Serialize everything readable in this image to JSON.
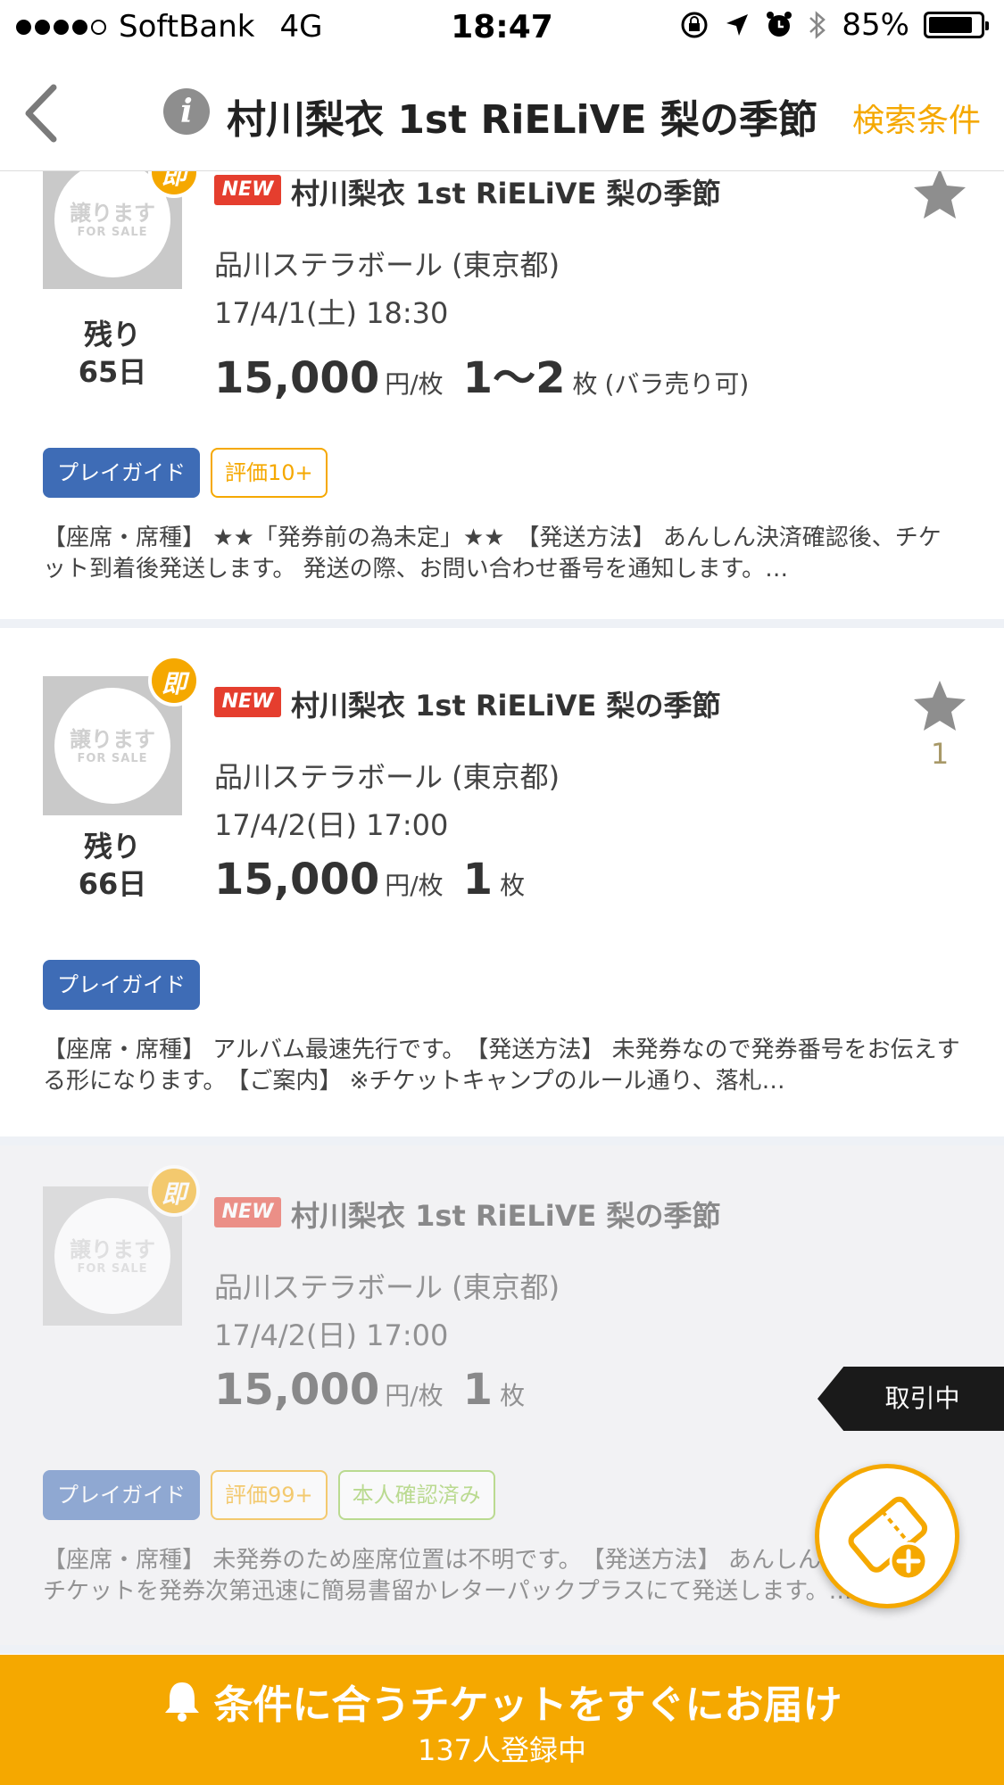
{
  "status_bar": {
    "carrier": "SoftBank",
    "network": "4G",
    "time": "18:47",
    "battery": "85%",
    "battery_level": 0.85
  },
  "nav": {
    "title": "村川梨衣 1st RiELiVE 梨の季節",
    "search_conditions": "検索条件"
  },
  "listings": [
    {
      "thumb_text": "譲ります",
      "thumb_sub": "FOR SALE",
      "instant_label": "即",
      "remaining_label": "残り",
      "remaining_days": "65日",
      "new_label": "NEW",
      "title": "村川梨衣 1st RiELiVE 梨の季節",
      "venue": "品川ステラボール (東京都)",
      "datetime": "17/4/1(土) 18:30",
      "price": "15,000",
      "price_unit": "円/枚",
      "quantity": "1〜2",
      "quantity_unit": "枚",
      "quantity_note": "(バラ売り可)",
      "favorite_count": "",
      "tags": [
        "プレイガイド",
        "評価10+"
      ],
      "description": "【座席・席種】 ★★「発券前の為未定」★★　【発送方法】 あんしん決済確認後、チケット到着後発送します。 発送の際、お問い合わせ番号を通知します。…"
    },
    {
      "thumb_text": "譲ります",
      "thumb_sub": "FOR SALE",
      "instant_label": "即",
      "remaining_label": "残り",
      "remaining_days": "66日",
      "new_label": "NEW",
      "title": "村川梨衣 1st RiELiVE 梨の季節",
      "venue": "品川ステラボール (東京都)",
      "datetime": "17/4/2(日) 17:00",
      "price": "15,000",
      "price_unit": "円/枚",
      "quantity": "1",
      "quantity_unit": "枚",
      "quantity_note": "",
      "favorite_count": "1",
      "tags": [
        "プレイガイド"
      ],
      "description": "【座席・席種】 アルバム最速先行です。　【発送方法】 未発券なので発券番号をお伝えする形になります。　【ご案内】 ※チケットキャンプのルール通り、落札…"
    },
    {
      "thumb_text": "譲ります",
      "thumb_sub": "FOR SALE",
      "instant_label": "即",
      "new_label": "NEW",
      "title": "村川梨衣 1st RiELiVE 梨の季節",
      "venue": "品川ステラボール (東京都)",
      "datetime": "17/4/2(日) 17:00",
      "price": "15,000",
      "price_unit": "円/枚",
      "quantity": "1",
      "quantity_unit": "枚",
      "quantity_note": "",
      "status": "取引中",
      "tags": [
        "プレイガイド",
        "評価99+",
        "本人確認済み"
      ],
      "description": "【座席・席種】 未発券のため座席位置は不明です。　【発送方法】 あんしん決済確認後、チケットを発券次第迅速に簡易書留かレターパックプラスにて発送します。…"
    }
  ],
  "bottom_bar": {
    "main": "条件に合うチケットをすぐにお届け",
    "sub": "137人登録中"
  },
  "colors": {
    "accent": "#f5a800",
    "new_badge": "#e53e2e",
    "guide_tag": "#3e6cb6",
    "verified_tag": "#8cc63f"
  },
  "icons": {
    "back": "chevron-left-icon",
    "info": "info-icon",
    "favorite": "star-icon",
    "fab": "ticket-add-icon",
    "bell": "bell-icon"
  }
}
